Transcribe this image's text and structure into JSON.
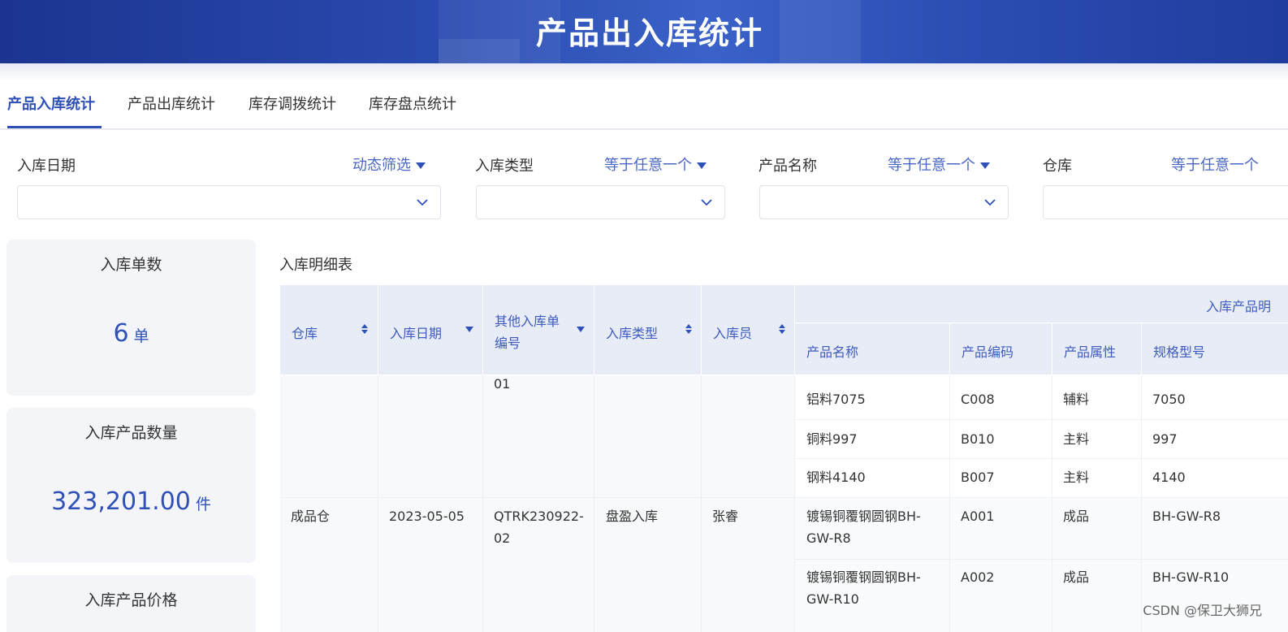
{
  "app": {
    "title": "产品出入库统计",
    "watermark": "CSDN @保卫大狮兄"
  },
  "tabs": [
    {
      "label": "产品入库统计",
      "active": true
    },
    {
      "label": "产品出库统计",
      "active": false
    },
    {
      "label": "库存调拨统计",
      "active": false
    },
    {
      "label": "库存盘点统计",
      "active": false
    }
  ],
  "filters": [
    {
      "label": "入库日期",
      "operator": "动态筛选",
      "value": ""
    },
    {
      "label": "入库类型",
      "operator": "等于任意一个",
      "value": ""
    },
    {
      "label": "产品名称",
      "operator": "等于任意一个",
      "value": ""
    },
    {
      "label": "仓库",
      "operator": "等于任意一个",
      "value": ""
    }
  ],
  "kpis": [
    {
      "title": "入库单数",
      "value": "6",
      "unit": "单"
    },
    {
      "title": "入库产品数量",
      "value": "323,201.00",
      "unit": "件"
    },
    {
      "title": "入库产品价格",
      "value": "",
      "unit": ""
    }
  ],
  "detail_table": {
    "title": "入库明细表",
    "group_header": "入库产品明",
    "columns": [
      "仓库",
      "入库日期",
      "其他入库单编号",
      "入库类型",
      "入库员"
    ],
    "col3_lines": [
      "其他入库单",
      "编号"
    ],
    "sub_columns": [
      "产品名称",
      "产品编码",
      "产品属性",
      "规格型号"
    ],
    "sort_icons": [
      "sort-both-icon",
      "sort-desc-icon",
      "sort-desc-icon",
      "sort-both-icon",
      "sort-both-icon"
    ],
    "groups": [
      {
        "warehouse": "",
        "date": "",
        "order_no_lines": [
          "01"
        ],
        "type": "",
        "clerk": "",
        "rows": [
          {
            "name": [
              "铝料7075"
            ],
            "code": "C008",
            "attr": "辅料",
            "spec": "7050"
          },
          {
            "name": [
              "铜料997"
            ],
            "code": "B010",
            "attr": "主料",
            "spec": "997"
          },
          {
            "name": [
              "钢料4140"
            ],
            "code": "B007",
            "attr": "主料",
            "spec": "4140"
          }
        ]
      },
      {
        "warehouse": "成品仓",
        "date": "2023-05-05",
        "order_no_lines": [
          "QTRK230922-",
          "02"
        ],
        "type": "盘盈入库",
        "clerk": "张睿",
        "rows": [
          {
            "name": [
              "镀锡铜覆钢圆钢BH-",
              "GW-R8"
            ],
            "code": "A001",
            "attr": "成品",
            "spec": "BH-GW-R8"
          },
          {
            "name": [
              "镀锡铜覆钢圆钢BH-",
              "GW-R10"
            ],
            "code": "A002",
            "attr": "成品",
            "spec": "BH-GW-R10"
          }
        ]
      }
    ]
  },
  "colors": {
    "accent": "#2f51b7",
    "header_bg": "#e8ecf7",
    "card_bg": "#f4f5f8"
  }
}
